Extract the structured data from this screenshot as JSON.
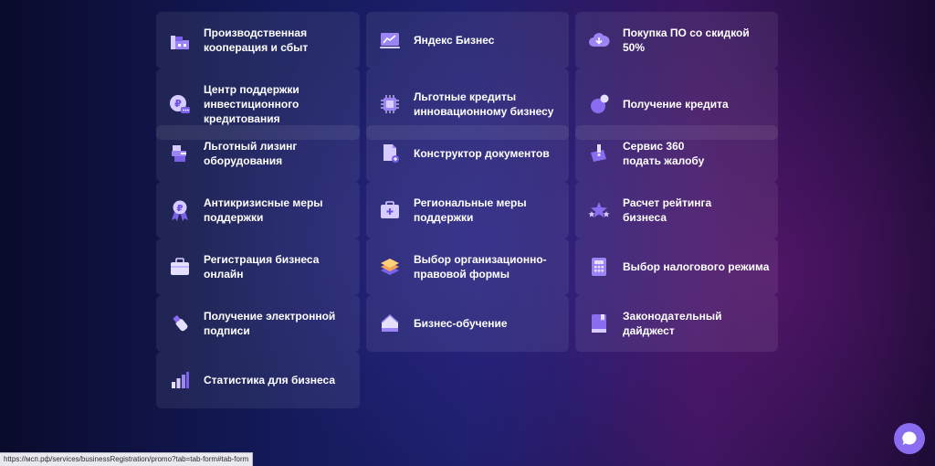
{
  "tiles": [
    {
      "label": "Производственная\nкооперация и сбыт",
      "icon": "factory-icon"
    },
    {
      "label": "Яндекс Бизнес",
      "icon": "growth-chart-icon"
    },
    {
      "label": "Покупка ПО со скидкой\n50%",
      "icon": "cloud-download-icon"
    },
    {
      "label": "Центр поддержки\nинвестиционного\nкредитования",
      "icon": "ruble-chat-icon"
    },
    {
      "label": "Льготные кредиты\nинновационному бизнесу",
      "icon": "chip-icon"
    },
    {
      "label": "Получение кредита",
      "icon": "coin-icon"
    },
    {
      "label": "Льготный лизинг\nоборудования",
      "icon": "machine-icon"
    },
    {
      "label": "Конструктор документов",
      "icon": "document-icon"
    },
    {
      "label": "Сервис 360\nподать жалобу",
      "icon": "complaint-icon"
    },
    {
      "label": "Антикризисные меры\nподдержки",
      "icon": "ruble-badge-icon"
    },
    {
      "label": "Региональные меры\nподдержки",
      "icon": "medkit-icon"
    },
    {
      "label": "Расчет рейтинга\nбизнеса",
      "icon": "stars-icon"
    },
    {
      "label": "Регистрация бизнеса\nонлайн",
      "icon": "briefcase-icon"
    },
    {
      "label": "Выбор организационно-\nправовой формы",
      "icon": "layers-icon"
    },
    {
      "label": "Выбор налогового режима",
      "icon": "calculator-icon"
    },
    {
      "label": "Получение электронной\nподписи",
      "icon": "usb-key-icon"
    },
    {
      "label": "Бизнес-обучение",
      "icon": "school-icon"
    },
    {
      "label": "Законодательный\nдайджест",
      "icon": "book-icon"
    },
    {
      "label": "Статистика для бизнеса",
      "icon": "bar-chart-icon"
    }
  ],
  "status_url": "https://мсп.рф/services/businessRegistration/promo?tab=tab-form#tab-form",
  "chat_icon": "chat-bubble-icon",
  "colors": {
    "accent": "#8a6cf0",
    "icon_light": "#d6ccff",
    "icon_mid": "#9c84f5",
    "icon_deep": "#6a4ee0",
    "text": "#ffffff"
  }
}
